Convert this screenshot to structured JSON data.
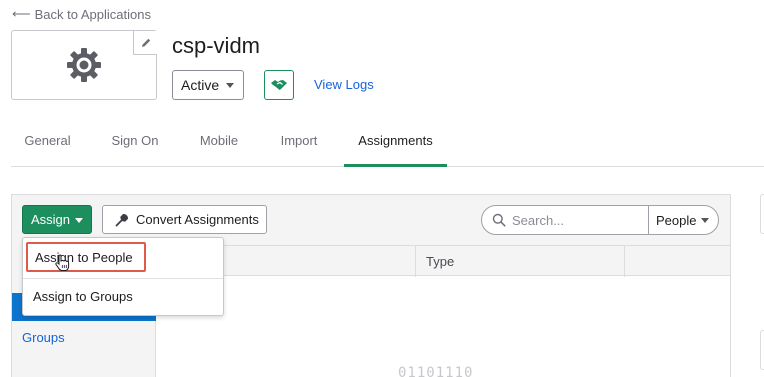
{
  "back_link": {
    "label": "Back to Applications",
    "arrow_icon": "arrow-left-icon"
  },
  "app": {
    "title": "csp-vidm",
    "logo_icon": "gear-icon",
    "edit_icon": "pencil-icon",
    "status": "Active",
    "provisioning_icon": "handshake-icon",
    "view_logs_label": "View Logs"
  },
  "tabs": [
    {
      "label": "General"
    },
    {
      "label": "Sign On"
    },
    {
      "label": "Mobile"
    },
    {
      "label": "Import"
    },
    {
      "label": "Assignments",
      "active": true
    }
  ],
  "toolbar": {
    "assign_label": "Assign",
    "convert_label": "Convert Assignments",
    "search_placeholder": "Search...",
    "filter_value": "People"
  },
  "dropdown": {
    "items": [
      {
        "label": "Assign to People"
      },
      {
        "label": "Assign to Groups"
      }
    ]
  },
  "sidebar": {
    "groups_label": "Groups"
  },
  "table": {
    "columns": [
      {
        "label": "Type"
      }
    ],
    "empty_art": "01101110"
  },
  "colors": {
    "accent_green": "#1d8f5f",
    "link_blue": "#1662dd",
    "selected_blue": "#0c74cc",
    "highlight_red": "#e05a4a"
  }
}
